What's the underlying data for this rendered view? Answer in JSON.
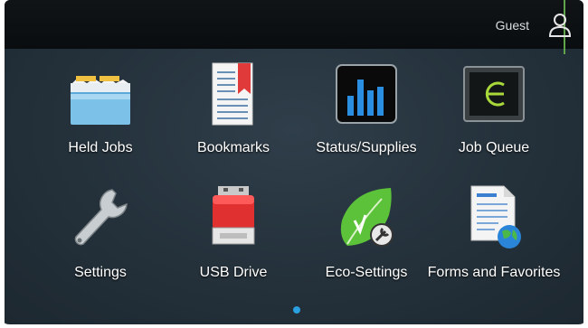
{
  "header": {
    "user_label": "Guest",
    "user_icon": "person-icon"
  },
  "tiles": [
    {
      "label": "Held Jobs",
      "icon": "folder-icon"
    },
    {
      "label": "Bookmarks",
      "icon": "bookmark-document-icon"
    },
    {
      "label": "Status/Supplies",
      "icon": "bar-chart-icon"
    },
    {
      "label": "Job Queue",
      "icon": "job-queue-monitor-icon"
    },
    {
      "label": "Settings",
      "icon": "wrench-icon"
    },
    {
      "label": "USB Drive",
      "icon": "usb-drive-icon"
    },
    {
      "label": "Eco-Settings",
      "icon": "eco-leaf-icon"
    },
    {
      "label": "Forms and Favorites",
      "icon": "forms-globe-icon"
    }
  ],
  "pager": {
    "current_page": 1,
    "total_pages": 1
  },
  "colors": {
    "accent_blue": "#2aa0e0",
    "accent_green": "#5fa34b",
    "background": "#263440"
  }
}
